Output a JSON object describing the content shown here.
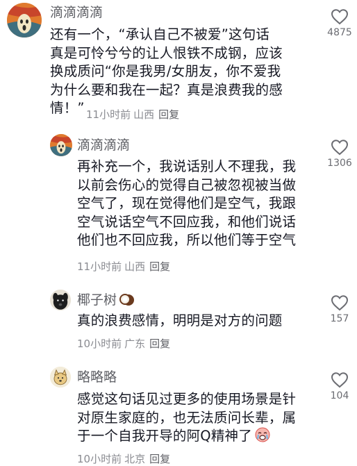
{
  "comments": [
    {
      "username": "滴滴滴滴",
      "lines": [
        "还有一个，“承认自己不被爱”这句话",
        "真是可怜兮兮的让人恨铁不成钢，应该",
        "换成质问“你是我男/女朋友，你不爱我",
        "为什么要和我在一起？真是浪费我的感",
        "情！”"
      ],
      "time": "11小时前",
      "location": "山西",
      "reply_label": "回复",
      "likes": "4875",
      "avatar_icon": "scream-painting-avatar"
    },
    {
      "username": "滴滴滴滴",
      "lines": [
        "再补充一个，我说话别人不理我，我",
        "以前会伤心的觉得自己被忽视被当做",
        "空气了，现在觉得他们是空气，我跟",
        "空气说话空气不回应我，和他们说话",
        "他们也不回应我，所以他们等于空气"
      ],
      "time": "11小时前",
      "location": "山西",
      "reply_label": "回复",
      "likes": "1306",
      "avatar_icon": "scream-painting-avatar"
    },
    {
      "username": "椰子树",
      "username_emoji": "coconut-emoji",
      "lines": [
        "真的浪费感情，明明是对方的问题"
      ],
      "time": "10小时前",
      "location": "广东",
      "reply_label": "回复",
      "likes": "157",
      "avatar_icon": "black-dog-avatar"
    },
    {
      "username": "略略略",
      "lines": [
        "感觉这句话见过更多的使用场景是针",
        "对原生家庭的，也无法质问长辈，属",
        "于一个自我开导的阿Q精神了"
      ],
      "body_end_emoji": "crying-face-emoji",
      "time": "10小时前",
      "location": "北京",
      "reply_label": "回复",
      "likes": "104",
      "avatar_icon": "cartoon-doge-avatar"
    }
  ],
  "colors": {
    "text": "#161823",
    "username": "#5f6066",
    "meta": "#8a8b91",
    "icon": "#6b6c72"
  }
}
